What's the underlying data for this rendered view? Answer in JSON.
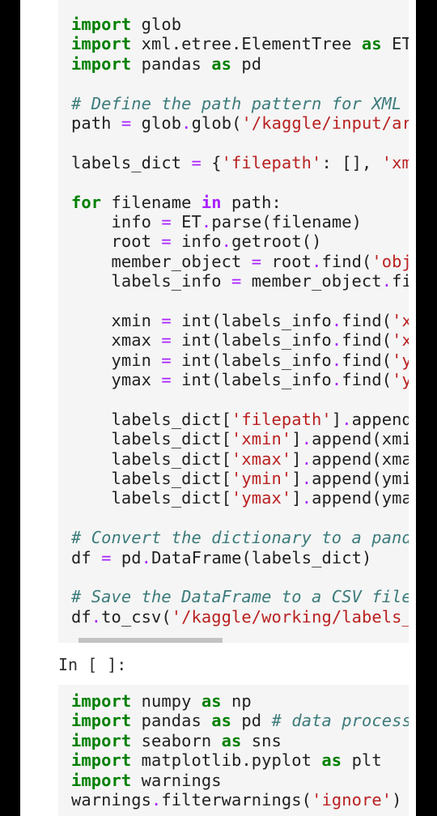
{
  "cell1": {
    "lines": [
      [
        [
          "k",
          "import"
        ],
        [
          "t",
          " glob"
        ]
      ],
      [
        [
          "k",
          "import"
        ],
        [
          "t",
          " xml.etree.ElementTree "
        ],
        [
          "k",
          "as"
        ],
        [
          "t",
          " ET"
        ]
      ],
      [
        [
          "k",
          "import"
        ],
        [
          "t",
          " pandas "
        ],
        [
          "k",
          "as"
        ],
        [
          "t",
          " pd"
        ]
      ],
      [],
      [
        [
          "c",
          "# Define the path pattern for XML"
        ]
      ],
      [
        [
          "t",
          "path "
        ],
        [
          "o",
          "="
        ],
        [
          "t",
          " glob"
        ],
        [
          "o",
          "."
        ],
        [
          "t",
          "glob("
        ],
        [
          "s",
          "'/kaggle/input/ar"
        ]
      ],
      [],
      [
        [
          "t",
          "labels_dict "
        ],
        [
          "o",
          "="
        ],
        [
          "t",
          " {"
        ],
        [
          "s",
          "'filepath'"
        ],
        [
          "t",
          ": [], "
        ],
        [
          "s",
          "'xm"
        ]
      ],
      [],
      [
        [
          "k",
          "for"
        ],
        [
          "t",
          " filename "
        ],
        [
          "kp",
          "in"
        ],
        [
          "t",
          " path:"
        ]
      ],
      [
        [
          "t",
          "    info "
        ],
        [
          "o",
          "="
        ],
        [
          "t",
          " ET"
        ],
        [
          "o",
          "."
        ],
        [
          "t",
          "parse(filename)"
        ]
      ],
      [
        [
          "t",
          "    root "
        ],
        [
          "o",
          "="
        ],
        [
          "t",
          " info"
        ],
        [
          "o",
          "."
        ],
        [
          "t",
          "getroot()"
        ]
      ],
      [
        [
          "t",
          "    member_object "
        ],
        [
          "o",
          "="
        ],
        [
          "t",
          " root"
        ],
        [
          "o",
          "."
        ],
        [
          "t",
          "find("
        ],
        [
          "s",
          "'obj"
        ]
      ],
      [
        [
          "t",
          "    labels_info "
        ],
        [
          "o",
          "="
        ],
        [
          "t",
          " member_object"
        ],
        [
          "o",
          "."
        ],
        [
          "t",
          "fi"
        ]
      ],
      [],
      [
        [
          "t",
          "    xmin "
        ],
        [
          "o",
          "="
        ],
        [
          "t",
          " int(labels_info"
        ],
        [
          "o",
          "."
        ],
        [
          "t",
          "find("
        ],
        [
          "s",
          "'x"
        ]
      ],
      [
        [
          "t",
          "    xmax "
        ],
        [
          "o",
          "="
        ],
        [
          "t",
          " int(labels_info"
        ],
        [
          "o",
          "."
        ],
        [
          "t",
          "find("
        ],
        [
          "s",
          "'x"
        ]
      ],
      [
        [
          "t",
          "    ymin "
        ],
        [
          "o",
          "="
        ],
        [
          "t",
          " int(labels_info"
        ],
        [
          "o",
          "."
        ],
        [
          "t",
          "find("
        ],
        [
          "s",
          "'y"
        ]
      ],
      [
        [
          "t",
          "    ymax "
        ],
        [
          "o",
          "="
        ],
        [
          "t",
          " int(labels_info"
        ],
        [
          "o",
          "."
        ],
        [
          "t",
          "find("
        ],
        [
          "s",
          "'y"
        ]
      ],
      [],
      [
        [
          "t",
          "    labels_dict["
        ],
        [
          "s",
          "'filepath'"
        ],
        [
          "t",
          "]"
        ],
        [
          "o",
          "."
        ],
        [
          "t",
          "append"
        ]
      ],
      [
        [
          "t",
          "    labels_dict["
        ],
        [
          "s",
          "'xmin'"
        ],
        [
          "t",
          "]"
        ],
        [
          "o",
          "."
        ],
        [
          "t",
          "append(xmi"
        ]
      ],
      [
        [
          "t",
          "    labels_dict["
        ],
        [
          "s",
          "'xmax'"
        ],
        [
          "t",
          "]"
        ],
        [
          "o",
          "."
        ],
        [
          "t",
          "append(xma"
        ]
      ],
      [
        [
          "t",
          "    labels_dict["
        ],
        [
          "s",
          "'ymin'"
        ],
        [
          "t",
          "]"
        ],
        [
          "o",
          "."
        ],
        [
          "t",
          "append(ymi"
        ]
      ],
      [
        [
          "t",
          "    labels_dict["
        ],
        [
          "s",
          "'ymax'"
        ],
        [
          "t",
          "]"
        ],
        [
          "o",
          "."
        ],
        [
          "t",
          "append(yma"
        ]
      ],
      [],
      [
        [
          "c",
          "# Convert the dictionary to a panda"
        ]
      ],
      [
        [
          "t",
          "df "
        ],
        [
          "o",
          "="
        ],
        [
          "t",
          " pd"
        ],
        [
          "o",
          "."
        ],
        [
          "t",
          "DataFrame(labels_dict)"
        ]
      ],
      [],
      [
        [
          "c",
          "# Save the DataFrame to a CSV file"
        ]
      ],
      [
        [
          "t",
          "df"
        ],
        [
          "o",
          "."
        ],
        [
          "t",
          "to_csv("
        ],
        [
          "s",
          "'/kaggle/working/labels_"
        ]
      ]
    ]
  },
  "prompt": "In [ ]:",
  "cell2": {
    "lines": [
      [
        [
          "k",
          "import"
        ],
        [
          "t",
          " numpy "
        ],
        [
          "k",
          "as"
        ],
        [
          "t",
          " np"
        ]
      ],
      [
        [
          "k",
          "import"
        ],
        [
          "t",
          " pandas "
        ],
        [
          "k",
          "as"
        ],
        [
          "t",
          " pd "
        ],
        [
          "c",
          "# data process"
        ]
      ],
      [
        [
          "k",
          "import"
        ],
        [
          "t",
          " seaborn "
        ],
        [
          "k",
          "as"
        ],
        [
          "t",
          " sns"
        ]
      ],
      [
        [
          "k",
          "import"
        ],
        [
          "t",
          " matplotlib.pyplot "
        ],
        [
          "k",
          "as"
        ],
        [
          "t",
          " plt"
        ]
      ],
      [
        [
          "k",
          "import"
        ],
        [
          "t",
          " warnings"
        ]
      ],
      [
        [
          "t",
          "warnings"
        ],
        [
          "o",
          "."
        ],
        [
          "t",
          "filterwarnings("
        ],
        [
          "s",
          "'ignore'"
        ],
        [
          "t",
          ")"
        ]
      ]
    ]
  },
  "colors": {
    "keyword": "#008000",
    "keyword_in": "#aa22ff",
    "operator": "#aa22ff",
    "string": "#ba2121",
    "comment": "#3d7b7b",
    "text": "#212121",
    "cell_background": "#f5f5f5",
    "page_background": "#ffffff",
    "outer_background": "#000000"
  }
}
